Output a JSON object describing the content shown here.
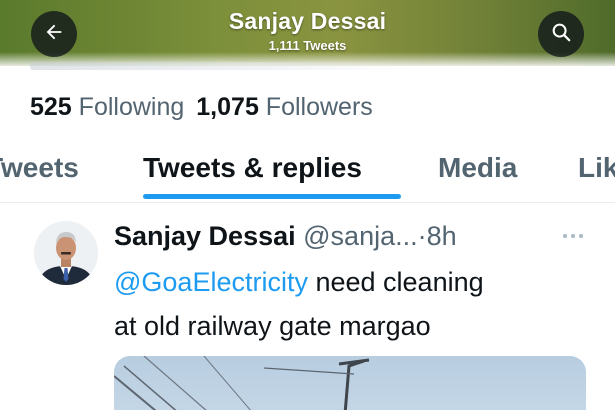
{
  "header": {
    "title": "Sanjay Dessai",
    "subtitle": "1,111 Tweets",
    "back_icon": "arrow-left-icon",
    "search_icon": "search-icon",
    "banner_color": "#7c8f3a"
  },
  "stats": {
    "following_count": "525",
    "following_label": "Following",
    "followers_count": "1,075",
    "followers_label": "Followers"
  },
  "tabs": [
    {
      "label": "Tweets",
      "active": false
    },
    {
      "label": "Tweets & replies",
      "active": true
    },
    {
      "label": "Media",
      "active": false
    },
    {
      "label": "Lik",
      "active": false
    }
  ],
  "tweet": {
    "author_name": "Sanjay Dessai",
    "handle": "@sanja...",
    "separator": "·",
    "time": "8h",
    "mention": "@GoaElectricity",
    "text_line1": " need cleaning",
    "text_line2": "at old railway gate margao",
    "more_icon": "more-horizontal-icon"
  },
  "colors": {
    "accent": "#1d9bf0",
    "text_primary": "#0f1419",
    "text_secondary": "#536471"
  }
}
